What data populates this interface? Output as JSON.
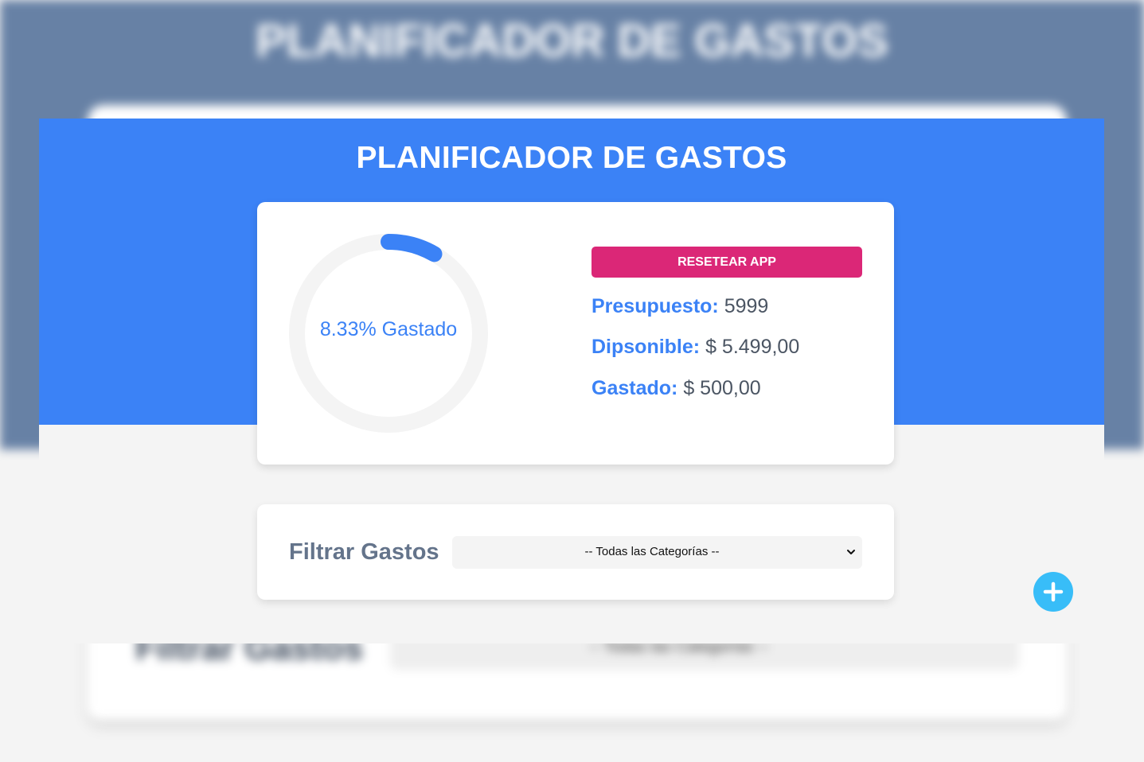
{
  "background": {
    "title": "PLANIFICADOR DE GASTOS",
    "filter_label": "Filtrar Gastos",
    "select_value": "-- Todas las Categorías --"
  },
  "header": {
    "title": "PLANIFICADOR DE GASTOS"
  },
  "budget": {
    "percent_spent": 8.33,
    "progress_label": "8.33% Gastado",
    "reset_label": "RESETEAR APP",
    "presupuesto_label": "Presupuesto:",
    "presupuesto_value": "5999",
    "disponible_label": "Dipsonible:",
    "disponible_value": "$ 5.499,00",
    "gastado_label": "Gastado:",
    "gastado_value": "$ 500,00"
  },
  "filter": {
    "label": "Filtrar Gastos",
    "selected": "-- Todas las Categorías --"
  },
  "icons": {
    "add": "plus-icon",
    "select_arrow": "chevron-down-icon"
  },
  "colors": {
    "primary": "#3b82f6",
    "reset": "#db2777",
    "add_button": "#38bdf8",
    "track": "#f4f4f4"
  }
}
